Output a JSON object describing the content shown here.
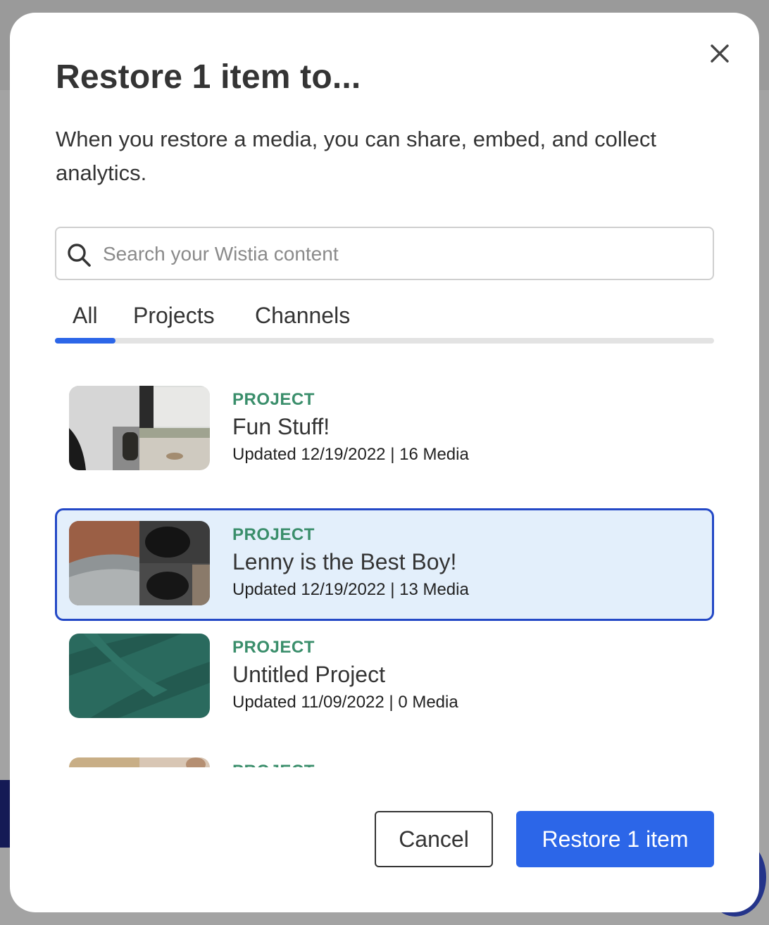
{
  "modal": {
    "title": "Restore 1 item to...",
    "description": "When you restore a media, you can share, embed, and collect analytics.",
    "close_icon": "close-icon"
  },
  "search": {
    "placeholder": "Search your Wistia content",
    "value": "",
    "icon": "search-icon"
  },
  "tabs": [
    {
      "label": "All",
      "active": true
    },
    {
      "label": "Projects",
      "active": false
    },
    {
      "label": "Channels",
      "active": false
    }
  ],
  "items": [
    {
      "kind": "PROJECT",
      "name": "Fun Stuff!",
      "meta": "Updated 12/19/2022 | 16 Media",
      "selected": false
    },
    {
      "kind": "PROJECT",
      "name": "Lenny is the Best Boy!",
      "meta": "Updated 12/19/2022 | 13 Media",
      "selected": true
    },
    {
      "kind": "PROJECT",
      "name": "Untitled Project",
      "meta": "Updated 11/09/2022 | 0 Media",
      "selected": false
    },
    {
      "kind": "PROJECT",
      "name": "",
      "meta": "",
      "selected": false
    }
  ],
  "actions": {
    "cancel_label": "Cancel",
    "restore_label": "Restore 1 item"
  },
  "colors": {
    "accent": "#2c66e8",
    "selected_border": "#2348c6",
    "selected_bg": "#e3effb",
    "kind_label": "#3a8e6b"
  }
}
